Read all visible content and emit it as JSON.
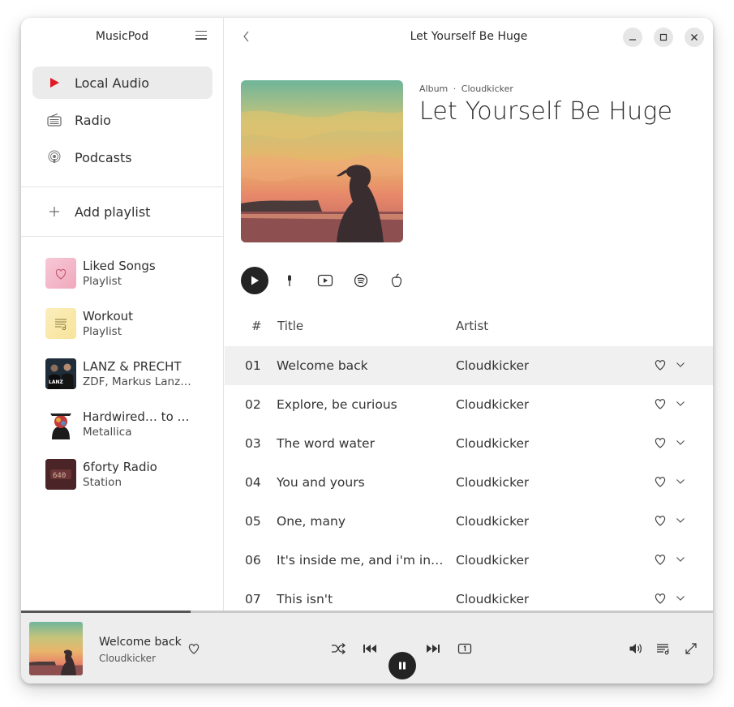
{
  "sidebar": {
    "app_title": "MusicPod",
    "nav": [
      {
        "label": "Local Audio",
        "icon": "play-icon"
      },
      {
        "label": "Radio",
        "icon": "radio-icon"
      },
      {
        "label": "Podcasts",
        "icon": "podcast-icon"
      }
    ],
    "add_playlist_label": "Add playlist",
    "playlists": [
      {
        "name": "Liked Songs",
        "sub": "Playlist",
        "icon": "heart-icon"
      },
      {
        "name": "Workout",
        "sub": "Playlist",
        "icon": "playlist-icon"
      },
      {
        "name": "LANZ & PRECHT",
        "sub": "ZDF, Markus Lanz & Richard David Precht"
      },
      {
        "name": "Hardwired… to Self-Destruct",
        "sub": "Metallica"
      },
      {
        "name": "6forty Radio",
        "sub": "Station"
      }
    ]
  },
  "header": {
    "title": "Let Yourself Be Huge"
  },
  "album": {
    "type_label": "Album",
    "separator": "·",
    "artist": "Cloudkicker",
    "title": "Let Yourself Be Huge"
  },
  "table": {
    "headers": {
      "num": "#",
      "title": "Title",
      "artist": "Artist"
    },
    "rows": [
      {
        "num": "01",
        "title": "Welcome back",
        "artist": "Cloudkicker"
      },
      {
        "num": "02",
        "title": "Explore, be curious",
        "artist": "Cloudkicker"
      },
      {
        "num": "03",
        "title": "The word water",
        "artist": "Cloudkicker"
      },
      {
        "num": "04",
        "title": "You and yours",
        "artist": "Cloudkicker"
      },
      {
        "num": "05",
        "title": "One, many",
        "artist": "Cloudkicker"
      },
      {
        "num": "06",
        "title": "It's inside me, and i'm inside it",
        "artist": "Cloudkicker"
      },
      {
        "num": "07",
        "title": "This isn't",
        "artist": "Cloudkicker"
      }
    ]
  },
  "player": {
    "title": "Welcome back",
    "artist": "Cloudkicker",
    "progress": 0.245
  },
  "colors": {
    "accent": "#e01b24",
    "dark_button": "#232323",
    "selected_row": "#f0f0f0",
    "sidebar_active": "#ebebeb",
    "player_bg": "#ededed"
  }
}
